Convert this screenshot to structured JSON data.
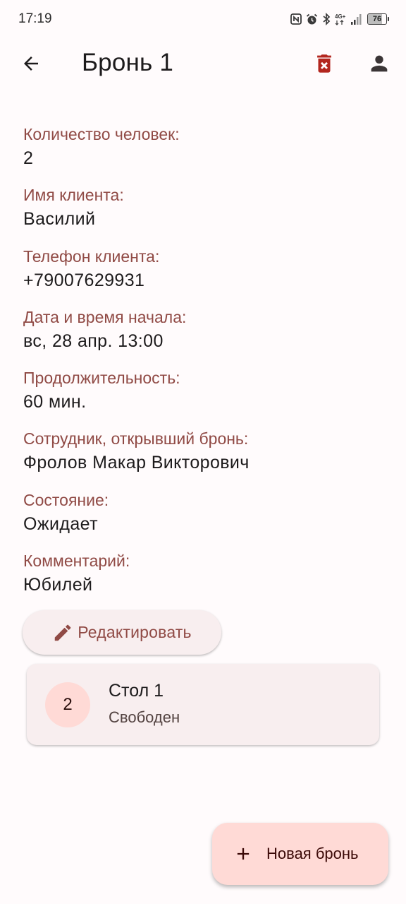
{
  "status_bar": {
    "time": "17:19",
    "battery": "76",
    "icons": [
      "nfc-icon",
      "alarm-icon",
      "bluetooth-icon",
      "network-4g-icon",
      "signal-icon",
      "battery-icon"
    ]
  },
  "app_bar": {
    "title": "Бронь 1",
    "back_icon": "arrow-back-icon",
    "delete_icon": "delete-forever-icon",
    "profile_icon": "person-icon"
  },
  "details": {
    "fields": [
      {
        "label": "Количество человек:",
        "value": "2"
      },
      {
        "label": "Имя клиента:",
        "value": "Василий"
      },
      {
        "label": "Телефон клиента:",
        "value": "+79007629931"
      },
      {
        "label": "Дата и время начала:",
        "value": "вс, 28 апр. 13:00"
      },
      {
        "label": "Продолжительность:",
        "value": "60 мин."
      },
      {
        "label": "Сотрудник, открывший бронь:",
        "value": "Фролов Макар Викторович"
      },
      {
        "label": "Состояние:",
        "value": "Ожидает"
      },
      {
        "label": "Комментарий:",
        "value": "Юбилей"
      }
    ]
  },
  "edit_button": {
    "label": "Редактировать",
    "icon": "edit-pencil-icon"
  },
  "table_card": {
    "badge": "2",
    "name": "Стол 1",
    "status": "Свободен"
  },
  "fab": {
    "label": "Новая бронь",
    "icon": "add-icon"
  },
  "colors": {
    "background": "#fffbfc",
    "label": "#904a45",
    "delete": "#b3261e",
    "surface": "#f8eeef",
    "container": "#ffdad6"
  }
}
